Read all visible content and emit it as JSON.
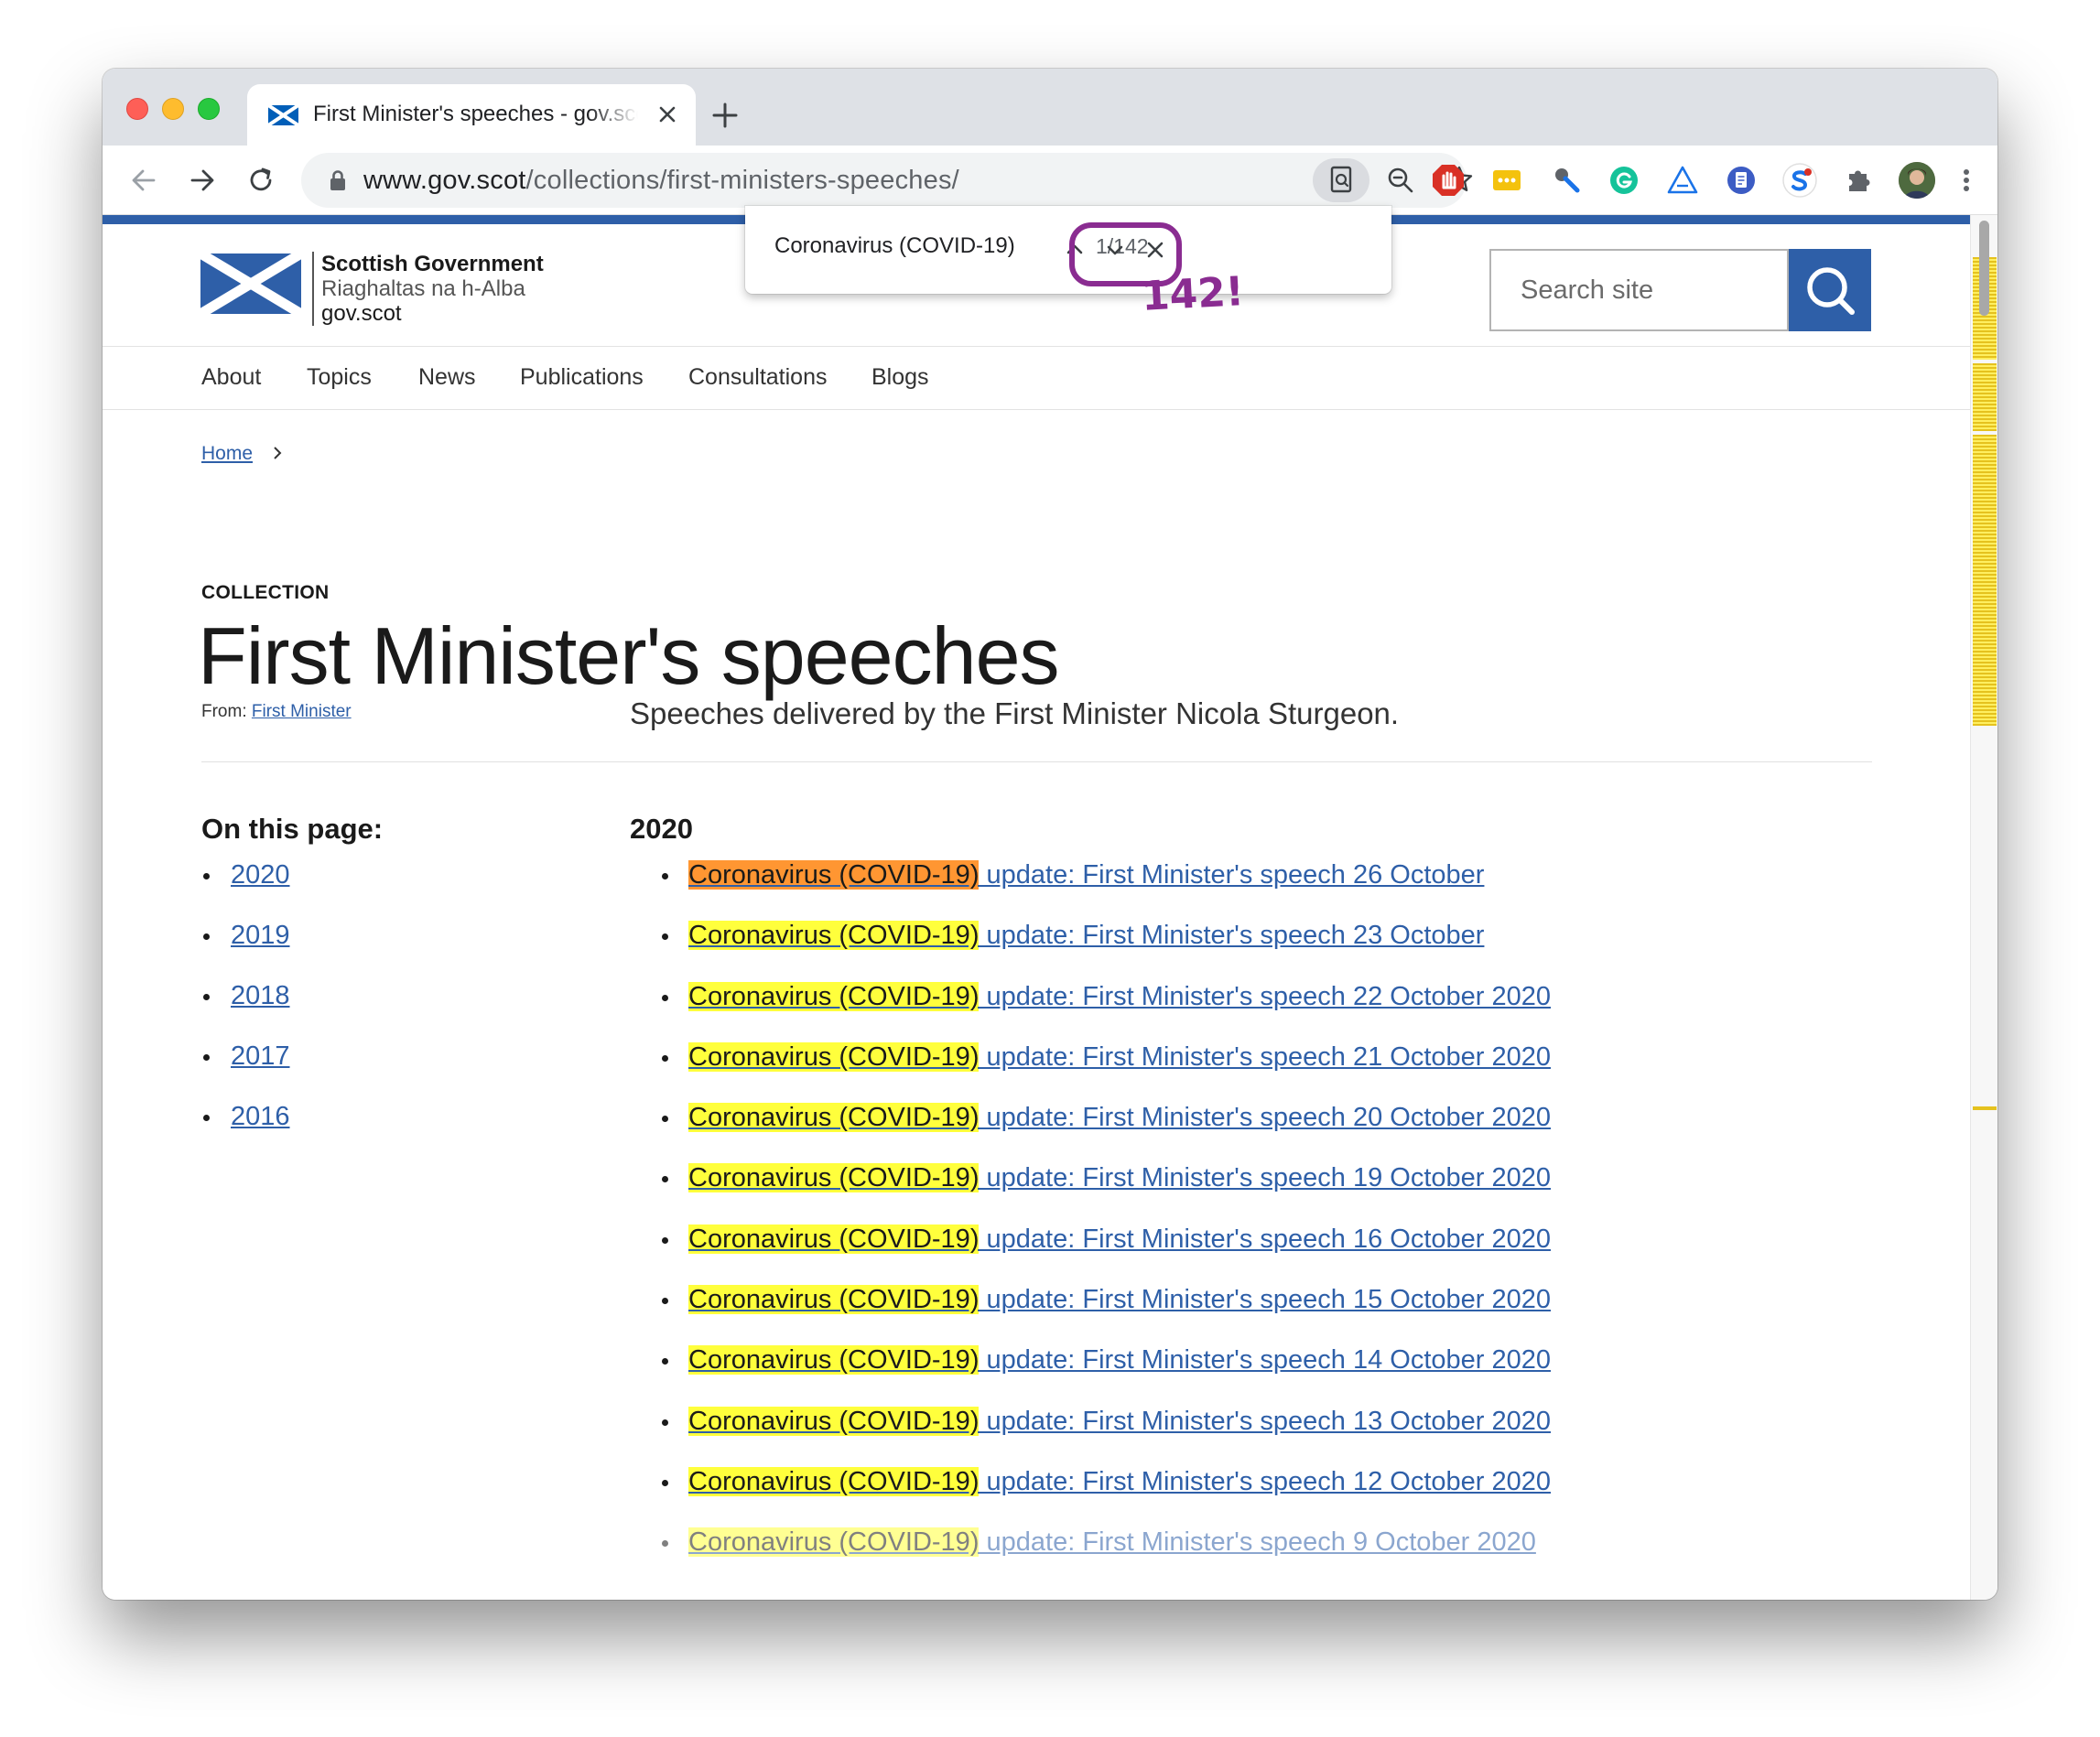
{
  "browser": {
    "tab_title": "First Minister's speeches - gov.scot",
    "url_host": "www.gov.scot",
    "url_path": "/collections/first-ministers-speeches/"
  },
  "find": {
    "query": "Coronavirus (COVID-19)",
    "count": "1/142",
    "annotation": "142!"
  },
  "site": {
    "logo_line1": "Scottish Government",
    "logo_line2": "Riaghaltas na h-Alba",
    "logo_line3": "gov.scot",
    "search_placeholder": "Search site",
    "brand_color": "#2e5fa8"
  },
  "nav": [
    "About",
    "Topics",
    "News",
    "Publications",
    "Consultations",
    "Blogs"
  ],
  "breadcrumb": {
    "home": "Home"
  },
  "collection": {
    "label": "COLLECTION",
    "title": "First Minister's speeches",
    "from_label": "From:",
    "from_link": "First Minister",
    "summary": "Speeches delivered by the First Minister Nicola Sturgeon."
  },
  "on_this_page": {
    "heading": "On this page:",
    "years": [
      "2020",
      "2019",
      "2018",
      "2017",
      "2016"
    ]
  },
  "section": {
    "year": "2020",
    "match_text": "Coronavirus (COVID-19)",
    "items": [
      " update: First Minister's speech 26 October",
      " update: First Minister's speech 23 October",
      " update: First Minister's speech 22 October 2020",
      " update: First Minister's speech 21 October 2020",
      " update: First Minister's speech 20 October 2020",
      " update: First Minister's speech 19 October 2020",
      " update: First Minister's speech 16 October 2020",
      " update: First Minister's speech 15 October 2020",
      " update: First Minister's speech 14 October 2020",
      " update: First Minister's speech 13 October 2020",
      " update: First Minister's speech 12 October 2020",
      " update: First Minister's speech 9 October 2020"
    ]
  },
  "colors": {
    "highlight": "#ffff3c",
    "active_highlight": "#ff9632",
    "annotation": "#8a2c91"
  }
}
